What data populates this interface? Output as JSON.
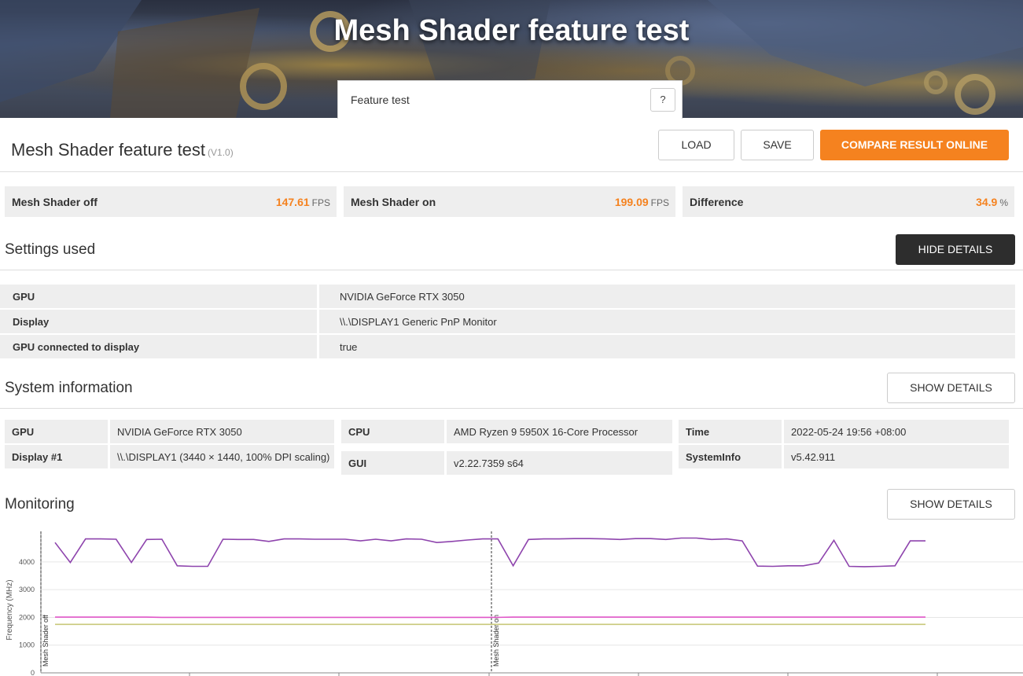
{
  "banner": {
    "title": "Mesh Shader feature test"
  },
  "test_select": {
    "value": "Feature test",
    "help": "?"
  },
  "result": {
    "title": "Mesh Shader feature test",
    "version": "(V1.0)",
    "load": "LOAD",
    "save": "SAVE",
    "compare": "COMPARE RESULT ONLINE"
  },
  "scores": [
    {
      "name": "Mesh Shader off",
      "value": "147.61",
      "unit": "FPS"
    },
    {
      "name": "Mesh Shader on",
      "value": "199.09",
      "unit": "FPS"
    },
    {
      "name": "Difference",
      "value": "34.9",
      "unit": "%"
    }
  ],
  "settings": {
    "title": "Settings used",
    "button": "HIDE DETAILS",
    "rows": [
      {
        "key": "GPU",
        "value": "NVIDIA GeForce RTX 3050"
      },
      {
        "key": "Display",
        "value": "\\\\.\\DISPLAY1 Generic PnP Monitor"
      },
      {
        "key": "GPU connected to display",
        "value": "true"
      }
    ]
  },
  "system": {
    "title": "System information",
    "button": "SHOW DETAILS",
    "gpu_k": "GPU",
    "gpu_v": "NVIDIA GeForce RTX 3050",
    "display_k": "Display #1",
    "display_v": "\\\\.\\DISPLAY1 (3440 × 1440, 100% DPI scaling)",
    "cpu_k": "CPU",
    "cpu_v": "AMD Ryzen 9 5950X 16-Core Processor",
    "gui_k": "GUI",
    "gui_v": "v2.22.7359 s64",
    "time_k": "Time",
    "time_v": "2022-05-24 19:56 +08:00",
    "sysinfo_k": "SystemInfo",
    "sysinfo_v": "v5.42.911"
  },
  "monitoring": {
    "title": "Monitoring",
    "button": "SHOW DETAILS"
  },
  "colors": {
    "accent": "#f5821f",
    "purple": "#8e44ad",
    "pink": "#e056c8",
    "olive": "#c8c87a"
  },
  "chart_data": {
    "type": "line",
    "ylabel": "Frequency (MHz)",
    "yticks": [
      "0",
      "1000",
      "2000",
      "3000",
      "4000"
    ],
    "ylim": [
      0,
      5000
    ],
    "markers": [
      {
        "label": "Mesh Shader off",
        "x": 0
      },
      {
        "label": "Mesh Shader on",
        "x": 30
      }
    ],
    "series": [
      {
        "color": "#8e44ad",
        "values": [
          4700,
          3980,
          4830,
          4830,
          4820,
          3980,
          4810,
          4820,
          3860,
          3840,
          3840,
          4820,
          4810,
          4810,
          4740,
          4830,
          4830,
          4820,
          4820,
          4820,
          4760,
          4820,
          4760,
          4830,
          4820,
          4700,
          4740,
          4790,
          4830,
          4830,
          3860,
          4810,
          4830,
          4830,
          4840,
          4840,
          4830,
          4810,
          4840,
          4840,
          4810,
          4860,
          4860,
          4810,
          4830,
          4760,
          3850,
          3840,
          3860,
          3860,
          3960,
          4780,
          3840,
          3830,
          3840,
          3860,
          4760,
          4760
        ]
      },
      {
        "color": "#e056c8",
        "values": [
          2010,
          2010,
          2010,
          2010,
          2010,
          2010,
          2010,
          2000,
          2000,
          2000,
          2000,
          2000,
          2000,
          2000,
          2000,
          2000,
          2000,
          2000,
          2000,
          2000,
          2000,
          2000,
          2000,
          2000,
          2000,
          2000,
          2000,
          2000,
          2000,
          2000,
          2010,
          2010,
          2010,
          2010,
          2010,
          2010,
          2010,
          2010,
          2010,
          2010,
          2010,
          2010,
          2010,
          2010,
          2010,
          2010,
          2010,
          2010,
          2010,
          2010,
          2010,
          2010,
          2010,
          2010,
          2010,
          2010,
          2010,
          2010
        ]
      },
      {
        "color": "#c8c87a",
        "values": [
          1750,
          1750,
          1750,
          1750,
          1750,
          1750,
          1750,
          1750,
          1750,
          1750,
          1750,
          1750,
          1750,
          1750,
          1750,
          1750,
          1750,
          1750,
          1750,
          1750,
          1750,
          1750,
          1750,
          1750,
          1750,
          1750,
          1750,
          1750,
          1750,
          1750,
          1750,
          1750,
          1750,
          1750,
          1750,
          1750,
          1750,
          1750,
          1750,
          1750,
          1750,
          1750,
          1750,
          1750,
          1750,
          1750,
          1750,
          1750,
          1750,
          1750,
          1750,
          1750,
          1750,
          1750,
          1750,
          1750,
          1750,
          1750
        ]
      }
    ]
  }
}
